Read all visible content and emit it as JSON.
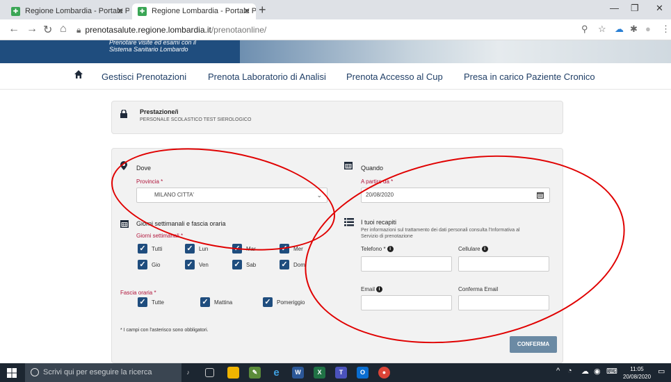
{
  "browser": {
    "tabs": [
      {
        "title": "Regione Lombardia - Portale Pre"
      },
      {
        "title": "Regione Lombardia - Portale Pre"
      }
    ],
    "url_host": "prenotasalute.regione.lombardia.it",
    "url_path": "/prenotaonline/"
  },
  "hero": {
    "line1": "Prenotare visite ed esami con il",
    "line2": "Sistema Sanitario Lombardo"
  },
  "nav": {
    "items": [
      {
        "label": "Gestisci Prenotazioni"
      },
      {
        "label": "Prenota Laboratorio di Analisi"
      },
      {
        "label": "Prenota Accesso al Cup"
      },
      {
        "label": "Presa in carico Paziente Cronico"
      }
    ]
  },
  "prestazione": {
    "title": "Prestazione/i",
    "value": "PERSONALE SCOLASTICO TEST SIEROLOGICO"
  },
  "dove": {
    "title": "Dove",
    "provincia_label": "Provincia *",
    "provincia_value": "MILANO CITTA'"
  },
  "quando": {
    "title": "Quando",
    "date_label": "A partire da *",
    "date_value": "20/08/2020"
  },
  "giorni": {
    "title": "Giorni settimanali e fascia oraria",
    "subtitle": "Giorni settimanali *",
    "days": [
      "Tutti",
      "Lun",
      "Mar",
      "Mer",
      "Gio",
      "Ven",
      "Sab",
      "Dom"
    ],
    "fascia_label": "Fascia oraria *",
    "fasce": [
      "Tutte",
      "Mattina",
      "Pomeriggio"
    ]
  },
  "recapiti": {
    "title": "I tuoi recapiti",
    "info_text": "Per informazioni sul trattamento dei dati personali consulta l'Informativa al Servizio di prenotazione",
    "telefono_label": "Telefono *",
    "cellulare_label": "Cellulare",
    "email_label": "Email",
    "conferma_email_label": "Conferma Email"
  },
  "footer": {
    "required_note": "* I campi con l'asterisco sono obbligatori.",
    "confirm_button": "CONFERMA"
  },
  "taskbar": {
    "search_placeholder": "Scrivi qui per eseguire la ricerca",
    "time": "11:05",
    "date": "20/08/2020"
  },
  "colors": {
    "primary": "#1f4d7e",
    "required": "#b0143a",
    "annotation": "#e00000",
    "confirm": "#6b8aa4"
  }
}
